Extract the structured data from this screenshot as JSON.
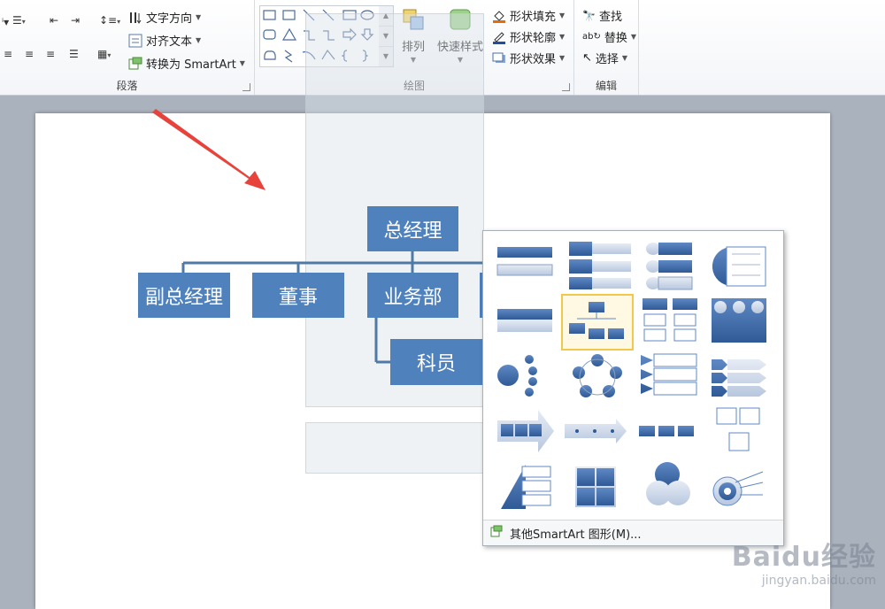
{
  "ribbon": {
    "paragraph": {
      "label": "段落",
      "text_direction": "文字方向",
      "align_text": "对齐文本",
      "convert_smartart": "转换为 SmartArt"
    },
    "drawing": {
      "label": "绘图",
      "arrange": "排列",
      "quick_styles": "快速样式",
      "shape_fill": "形状填充",
      "shape_outline": "形状轮廓",
      "shape_effects": "形状效果"
    },
    "editing": {
      "label": "编辑",
      "find": "查找",
      "replace": "替换",
      "select": "选择"
    }
  },
  "org_chart": {
    "top": "总经理",
    "level2": [
      "副总经理",
      "董事",
      "业务部"
    ],
    "level3": "科员"
  },
  "popup": {
    "footer": "其他SmartArt 图形(M)..."
  },
  "watermark": {
    "brand": "Baidu经验",
    "url": "jingyan.baidu.com"
  },
  "colors": {
    "box": "#4f81bd",
    "selected_tile": "#f2c84b",
    "arrow": "#e8433a"
  }
}
